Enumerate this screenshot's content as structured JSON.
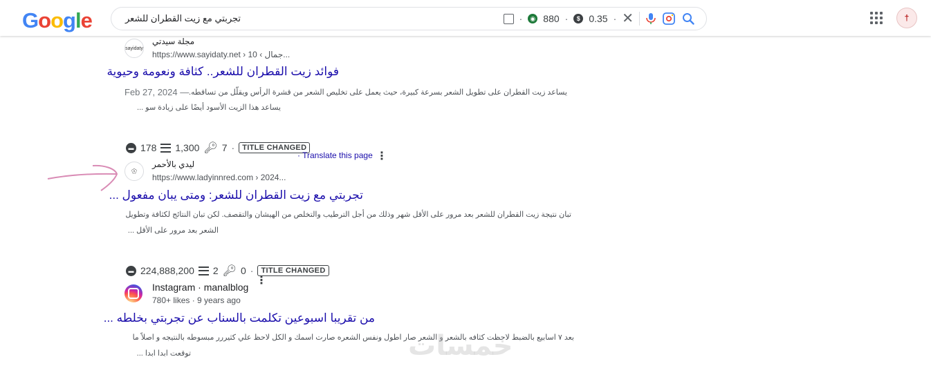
{
  "header": {
    "logo": [
      "G",
      "o",
      "o",
      "g",
      "l",
      "e"
    ],
    "logo_colors": [
      "#4285F4",
      "#EA4335",
      "#FBBC05",
      "#4285F4",
      "#34A853",
      "#EA4335"
    ],
    "query": "تجربتي مع زيت القطران للشعر",
    "stat1": "880",
    "stat2": "0.35",
    "coin1_glyph": "◉",
    "coin2_glyph": "$",
    "avatar_glyph": "†"
  },
  "results": [
    {
      "site_name": "مجلة سيدتي",
      "url": "https://www.sayidaty.net › جمال › 10...",
      "title": "فوائد زيت القطران للشعر.. كثافة ونعومة وحيوية",
      "date": "Feb 27, 2024 —",
      "snippet_lines": [
        "يساعد زيت القطران على تطويل الشعر بسرعة كبيرة، حيث يعمل على تخليص الشعر من قشرة الرأس ويقلّل من تساقطه.",
        "يساعد هذا الزيت الأسود أيضًا على زيادة سو ..."
      ]
    },
    {
      "metrics": [
        "178",
        "1,300",
        "7"
      ],
      "badge": "TITLE CHANGED",
      "translate": "Translate this page",
      "site_name": "ليدي بالأحمر",
      "url": "https://www.ladyinnred.com › 2024...",
      "title": "تجربتي مع زيت القطران للشعر: ومتى يبان مفعول ...",
      "snippet_lines": [
        "تبان نتيجة زيت القطران للشعر بعد مرور على الأقل شهر وذلك من أجل الترطيب والتخلص من الهيشان والتقصف. لكن تبان النتائج لكثافة وتطويل",
        "الشعر بعد مرور على الأقل ..."
      ]
    },
    {
      "metrics": [
        "224,888,200",
        "2",
        "0"
      ],
      "badge": "TITLE CHANGED",
      "site_name": "Instagram · manalblog",
      "url": "780+ likes · 9 years ago",
      "title": "من تقريبا اسبوعين تكلمت بالسناب عن تجربتي بخلطه ...",
      "snippet_lines": [
        "بعد ٧ اسابيع بالضبط لاحظت كثافه بالشعر و الشعر صار اطول ونفس الشعره صارت اسمك و الكل لاحظ علي كثيررر مبسوطه بالنتيجه و اصلاً ما",
        "توقعت ابدا ابدا ..."
      ]
    }
  ],
  "watermark": "خمسات"
}
